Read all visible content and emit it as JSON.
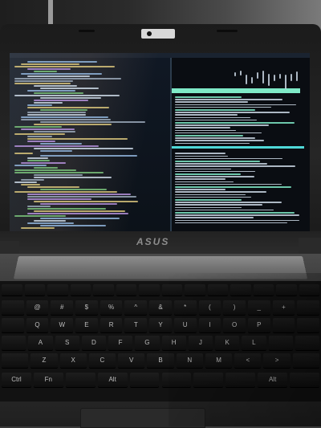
{
  "brand_logo": "ASUS",
  "keyboard_rows": [
    [
      "",
      "",
      "",
      "",
      "",
      "",
      "",
      "",
      "",
      "",
      "",
      "",
      "",
      ""
    ],
    [
      "",
      "@",
      "#",
      "$",
      "%",
      "^",
      "&",
      "*",
      "(",
      ")",
      "_",
      "+",
      ""
    ],
    [
      "",
      "Q",
      "W",
      "E",
      "R",
      "T",
      "Y",
      "U",
      "I",
      "O",
      "P",
      "",
      ""
    ],
    [
      "",
      "A",
      "S",
      "D",
      "F",
      "G",
      "H",
      "J",
      "K",
      "L",
      "",
      ""
    ],
    [
      "",
      "Z",
      "X",
      "C",
      "V",
      "B",
      "N",
      "M",
      "<",
      ">",
      ""
    ],
    [
      "Ctrl",
      "Fn",
      "",
      "Alt",
      "",
      "",
      "",
      "",
      "Alt",
      ""
    ]
  ],
  "colors": {
    "bezel": "#1b1b1b",
    "screen_bg": "#0b0f15",
    "htop_header": "#7fe9c7",
    "htop_bar": "#4fd8d8",
    "keys": "#141414"
  }
}
